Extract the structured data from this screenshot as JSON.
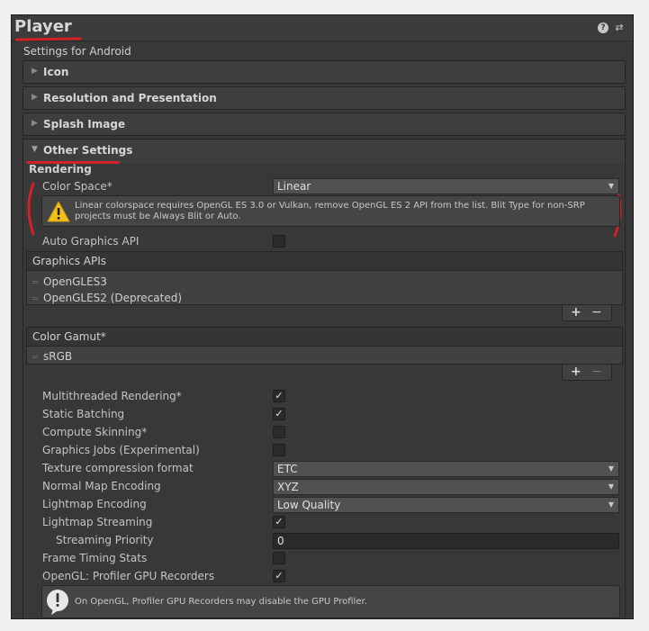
{
  "header": {
    "title": "Player",
    "help_icon": "?",
    "settings_icon": "⇄",
    "subtitle": "Settings for Android"
  },
  "foldouts": {
    "icon": "Icon",
    "resolution": "Resolution and Presentation",
    "splash": "Splash Image",
    "other": "Other Settings"
  },
  "rendering": {
    "heading": "Rendering",
    "color_space_label": "Color Space*",
    "color_space_value": "Linear",
    "color_space_warning": "Linear colorspace requires OpenGL ES 3.0 or Vulkan, remove OpenGL ES 2 API from the list. Blit Type for non-SRP projects must be Always Blit or Auto.",
    "auto_graphics_api_label": "Auto Graphics API",
    "auto_graphics_api_checked": false,
    "graphics_apis_header": "Graphics APIs",
    "graphics_apis": [
      "OpenGLES3",
      "OpenGLES2 (Deprecated)"
    ],
    "color_gamut_header": "Color Gamut*",
    "color_gamut_items": [
      "sRGB"
    ],
    "list_add": "+",
    "list_remove": "−"
  },
  "settings": {
    "multithreaded_rendering": {
      "label": "Multithreaded Rendering*",
      "checked": true
    },
    "static_batching": {
      "label": "Static Batching",
      "checked": true
    },
    "compute_skinning": {
      "label": "Compute Skinning*",
      "checked": false
    },
    "graphics_jobs": {
      "label": "Graphics Jobs (Experimental)",
      "checked": false
    },
    "texture_compression": {
      "label": "Texture compression format",
      "value": "ETC"
    },
    "normal_map_encoding": {
      "label": "Normal Map Encoding",
      "value": "XYZ"
    },
    "lightmap_encoding": {
      "label": "Lightmap Encoding",
      "value": "Low Quality"
    },
    "lightmap_streaming": {
      "label": "Lightmap Streaming",
      "checked": true
    },
    "streaming_priority": {
      "label": "Streaming Priority",
      "value": "0"
    },
    "frame_timing_stats": {
      "label": "Frame Timing Stats",
      "checked": false
    },
    "profiler_gpu_recorders": {
      "label": "OpenGL: Profiler GPU Recorders",
      "checked": true
    },
    "profiler_info": "On OpenGL, Profiler GPU Recorders may disable the GPU Profiler."
  },
  "colors": {
    "panel_bg": "#383838",
    "annotation_red": "#d42027",
    "warning_yellow": "#f2c01c"
  }
}
